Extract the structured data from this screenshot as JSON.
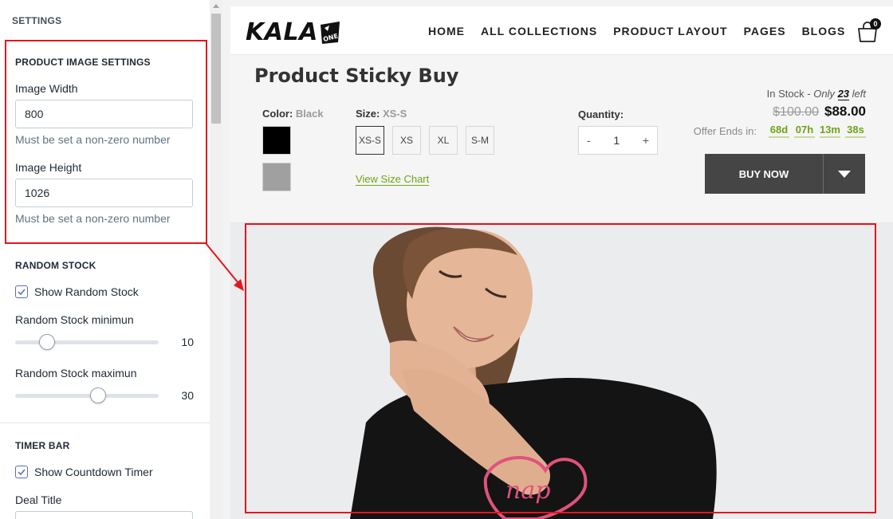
{
  "settings": {
    "title": "SETTINGS",
    "product_image": {
      "heading": "PRODUCT IMAGE SETTINGS",
      "width_label": "Image Width",
      "width_value": "800",
      "width_help": "Must be set a non-zero number",
      "height_label": "Image Height",
      "height_value": "1026",
      "height_help": "Must be set a non-zero number"
    },
    "random_stock": {
      "heading": "RANDOM STOCK",
      "show_label": "Show Random Stock",
      "show_checked": true,
      "min_label": "Random Stock minimun",
      "min_value": "10",
      "min_fraction": 0.22,
      "max_label": "Random Stock maximun",
      "max_value": "30",
      "max_fraction": 0.58
    },
    "timer_bar": {
      "heading": "TIMER BAR",
      "show_label": "Show Countdown Timer",
      "show_checked": true,
      "deal_title_label": "Deal Title"
    }
  },
  "preview": {
    "logo": "KALA",
    "logo_badge": "ONE",
    "nav": [
      "HOME",
      "ALL COLLECTIONS",
      "PRODUCT LAYOUT",
      "PAGES",
      "BLOGS"
    ],
    "cart_count": "0",
    "product_title": "Product Sticky Buy",
    "color_label": "Color:",
    "color_value": "Black",
    "colors": [
      "#000000",
      "#a0a0a0"
    ],
    "size_label": "Size:",
    "size_value": "XS-S",
    "sizes": [
      "XS-S",
      "XS",
      "XL",
      "S-M"
    ],
    "size_chart": "View Size Chart",
    "quantity_label": "Quantity:",
    "quantity_minus": "-",
    "quantity_value": "1",
    "quantity_plus": "+",
    "stock_prefix": "In Stock -",
    "stock_only": "Only",
    "stock_count": "23",
    "stock_suffix": "left",
    "old_price": "$100.00",
    "new_price": "$88.00",
    "offer_label": "Offer Ends in:",
    "timer": [
      "68d",
      "07h",
      "13m",
      "38s"
    ],
    "buy_now": "BUY NOW"
  },
  "colors": {
    "accent_green": "#6fa318",
    "highlight_red": "#e5151e",
    "checkbox_blue": "#5c6ac4",
    "buy_button": "#454545"
  }
}
